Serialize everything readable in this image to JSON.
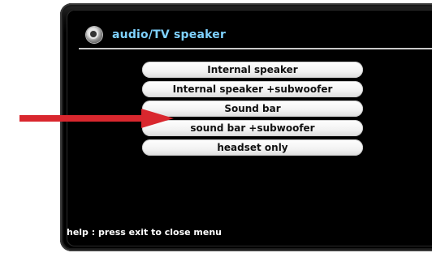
{
  "menu": {
    "title": "audio/TV speaker",
    "title_color": "#7fd2ff",
    "icon": "speaker-icon",
    "options": [
      "Internal speaker",
      "Internal speaker +subwoofer",
      "Sound bar",
      "sound bar +subwoofer",
      "headset only"
    ],
    "highlighted_option_index": 2
  },
  "help": {
    "text": "help : press exit to close menu"
  },
  "callout": {
    "type": "arrow-pointing-right",
    "color": "#d9272e"
  }
}
